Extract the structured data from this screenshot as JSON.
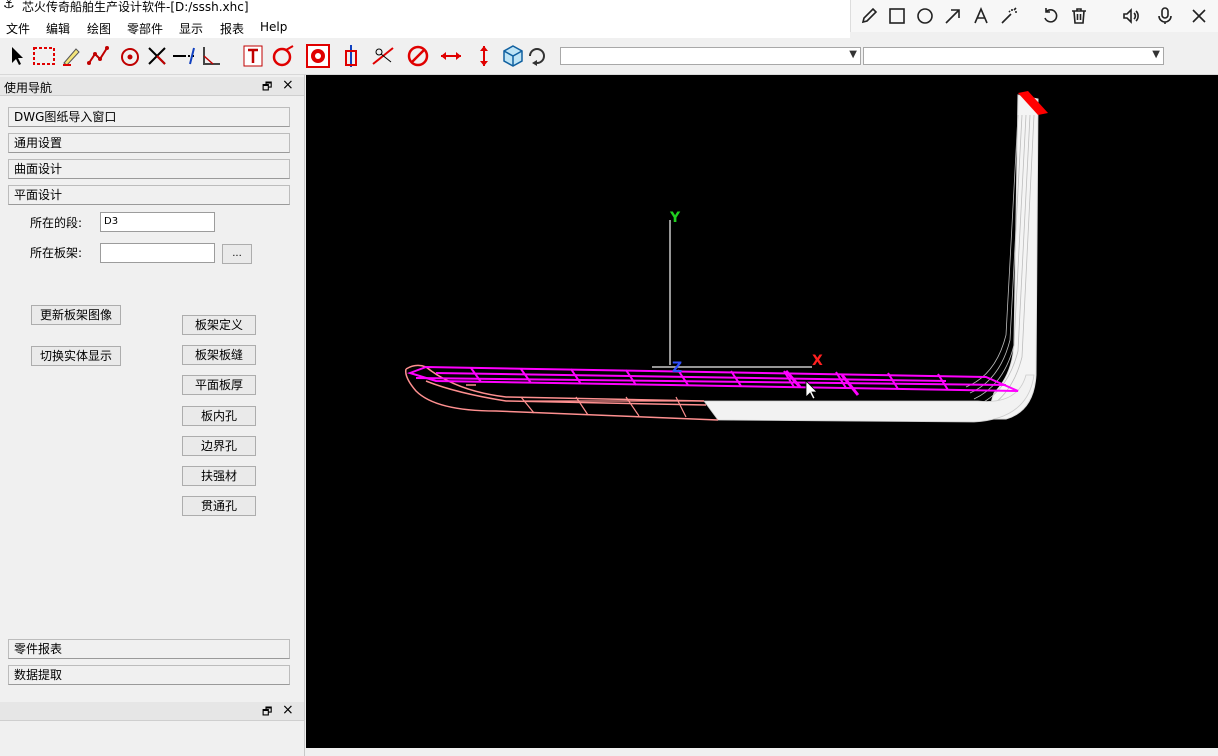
{
  "window": {
    "title": "芯火传奇船舶生产设计软件-[D:/sssh.xhc]"
  },
  "menu": [
    "文件",
    "编辑",
    "绘图",
    "零部件",
    "显示",
    "报表",
    "Help"
  ],
  "annotation_tools": [
    "pencil-icon",
    "rectangle-icon",
    "circle-icon",
    "arrow-icon",
    "text-icon",
    "magic-wand-icon",
    "undo-icon",
    "trash-icon",
    "speaker-icon",
    "microphone-icon",
    "close-icon"
  ],
  "toolbar": {
    "combo1_value": "",
    "combo2_value": ""
  },
  "nav": {
    "title": "使用导航",
    "sections_top": [
      "DWG图纸导入窗口",
      "通用设置",
      "曲面设计",
      "平面设计"
    ],
    "segment_label": "所在的段:",
    "segment_value": "D3",
    "frame_label": "所在板架:",
    "frame_value": "",
    "browse_label": "...",
    "left_buttons": [
      "更新板架图像",
      "切换实体显示"
    ],
    "right_buttons": [
      "板架定义",
      "板架板缝",
      "平面板厚",
      "板内孔",
      "边界孔",
      "扶强材",
      "贯通孔"
    ],
    "sections_bottom": [
      "零件报表",
      "数据提取"
    ]
  },
  "viewport": {
    "axis_x": "X",
    "axis_y": "Y",
    "axis_z": "Z",
    "colors": {
      "frame": "#ff00ff",
      "hull_outline": "#ff9090",
      "surface": "#ffffff",
      "axis_x": "#ff2020",
      "axis_y": "#20d020",
      "axis_z": "#3050ff",
      "cap": "#ff0000"
    }
  }
}
